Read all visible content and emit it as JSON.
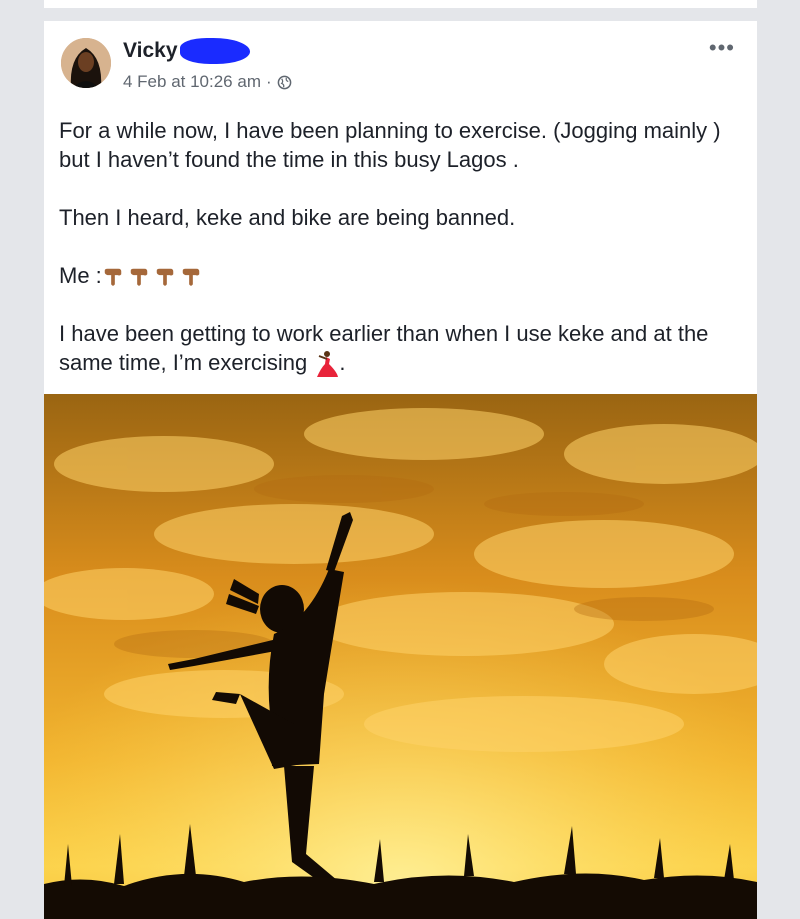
{
  "post": {
    "author": "Vicky",
    "timestamp": "4 Feb at 10:26 am",
    "separator": "·",
    "privacy_icon": "globe-icon",
    "more_label": "•••",
    "paragraphs": [
      "For a while now, I have been planning to exercise. (Jogging mainly ) but I haven’t found the time in this busy Lagos .",
      "Then I heard, keke and bike are being banned."
    ],
    "me_label": "Me :",
    "closing_text": "I have been getting to work earlier than when I use keke and at the same time, I’m exercising",
    "closing_period": ".",
    "emoji_icons": [
      "pointing-down-icon",
      "pointing-down-icon",
      "pointing-down-icon",
      "pointing-down-icon",
      "dancer-icon"
    ]
  },
  "colors": {
    "background": "#e4e6ea",
    "card": "#ffffff",
    "text": "#1d2129",
    "meta": "#606770",
    "redaction": "#1a2bff"
  }
}
